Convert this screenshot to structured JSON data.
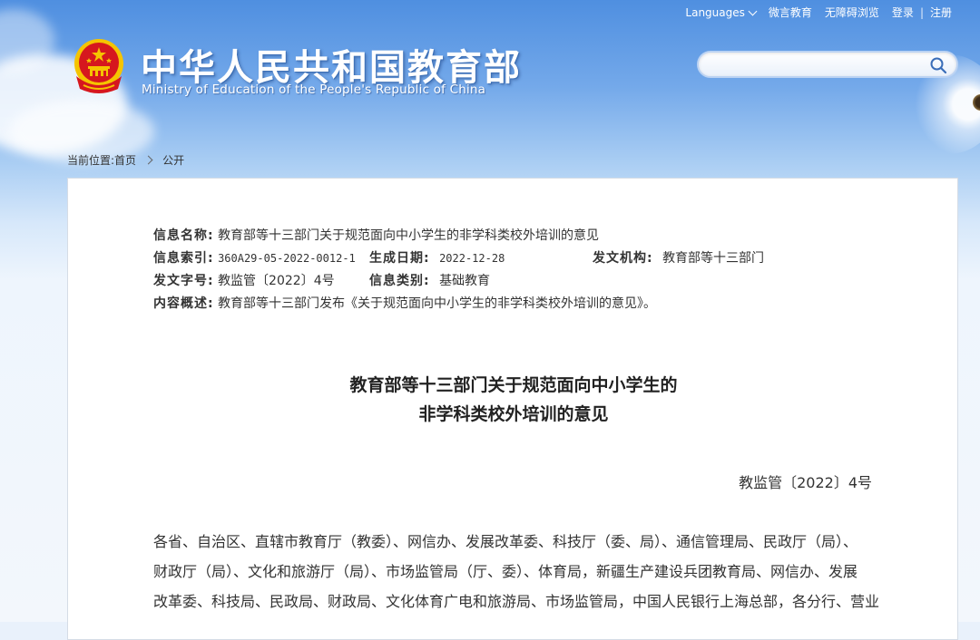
{
  "toplinks": {
    "languages": "Languages",
    "weibo": "微言教育",
    "accessible": "无障碍浏览",
    "login": "登录",
    "sep": "|",
    "register": "注册"
  },
  "header": {
    "title": "中华人民共和国教育部",
    "subtitle": "Ministry of Education of the People's Republic of China"
  },
  "search": {
    "placeholder": ""
  },
  "breadcrumb": {
    "prefix": "当前位置:",
    "home": "首页",
    "current": "公开"
  },
  "meta": {
    "name_label": "信息名称:",
    "name_value": "教育部等十三部门关于规范面向中小学生的非学科类校外培训的意见",
    "index_label": "信息索引:",
    "index_value": "360A29-05-2022-0012-1",
    "date_label": "生成日期:",
    "date_value": "2022-12-28",
    "org_label": "发文机构:",
    "org_value": "教育部等十三部门",
    "docno_label": "发文字号:",
    "docno_value": "教监管〔2022〕4号",
    "category_label": "信息类别:",
    "category_value": "基础教育",
    "summary_label": "内容概述:",
    "summary_value": "教育部等十三部门发布《关于规范面向中小学生的非学科类校外培训的意见》。"
  },
  "document": {
    "title_line1": "教育部等十三部门关于规范面向中小学生的",
    "title_line2": "非学科类校外培训的意见",
    "number": "教监管〔2022〕4号",
    "body_line1": "各省、自治区、直辖市教育厅（教委）、网信办、发展改革委、科技厅（委、局）、通信管理局、民政厅（局）、",
    "body_line2": "财政厅（局）、文化和旅游厅（局）、市场监管局（厅、委）、体育局，新疆生产建设兵团教育局、网信办、发展",
    "body_line3": "改革委、科技局、民政局、财政局、文化体育广电和旅游局、市场监管局，中国人民银行上海总部，各分行、营业"
  },
  "colors": {
    "header_blue": "#4f8fe0",
    "emblem_red": "#d6171e",
    "emblem_gold": "#f5c400"
  }
}
